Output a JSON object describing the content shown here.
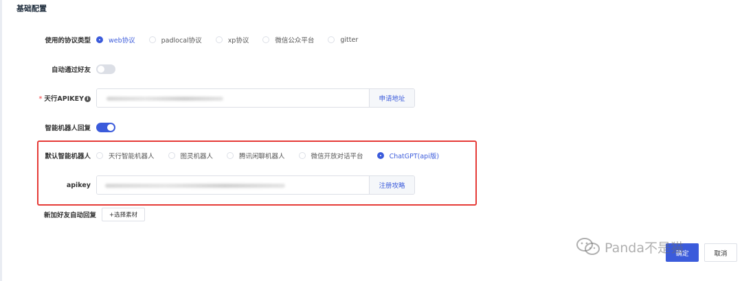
{
  "section": {
    "title": "基础配置"
  },
  "protocol": {
    "label": "使用的协议类型",
    "options": [
      "web协议",
      "padlocal协议",
      "xp协议",
      "微信公众平台",
      "gitter"
    ],
    "selected": "web协议"
  },
  "auto_accept": {
    "label": "自动通过好友",
    "enabled": false
  },
  "tianxing_apikey": {
    "label": "天行APIKEY",
    "required_mark": "*",
    "info_icon": "info-icon",
    "value": "",
    "append_label": "申请地址"
  },
  "robot_reply": {
    "label": "智能机器人回复",
    "enabled": true
  },
  "default_robot": {
    "label": "默认智能机器人",
    "options": [
      "天行智能机器人",
      "图灵机器人",
      "腾讯闲聊机器人",
      "微信开放对话平台",
      "ChatGPT(api版)"
    ],
    "selected": "ChatGPT(api版)"
  },
  "apikey": {
    "label": "apikey",
    "value": "",
    "append_label": "注册攻略"
  },
  "new_friend_reply": {
    "label": "新加好友自动回复",
    "button_label": "+选择素材"
  },
  "footer": {
    "confirm_label": "确定",
    "cancel_label": "取消"
  },
  "watermark": {
    "text": "Panda不是猫"
  },
  "colors": {
    "accent": "#3b5bdb",
    "highlight_border": "#e53935",
    "required": "#f56c6c"
  }
}
